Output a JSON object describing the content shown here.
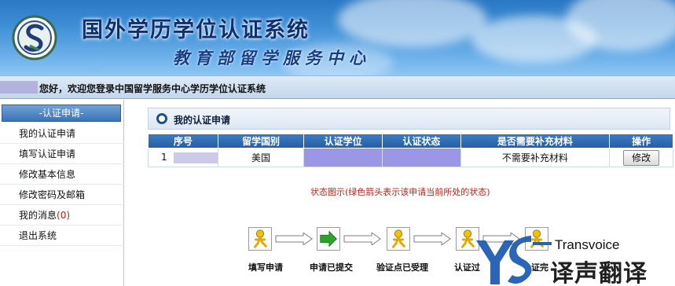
{
  "banner": {
    "title": "国外学历学位认证系统",
    "subtitle": "教育部留学服务中心"
  },
  "welcome": {
    "text": "您好，欢迎您登录中国留学服务中心学历学位认证系统"
  },
  "sidebar": {
    "header": "-认证申请-",
    "items": [
      {
        "label": "我的认证申请"
      },
      {
        "label": "填写认证申请"
      },
      {
        "label": "修改基本信息"
      },
      {
        "label": "修改密码及邮箱"
      },
      {
        "label": "我的消息",
        "badge": "(0)"
      },
      {
        "label": "退出系统"
      }
    ]
  },
  "panel": {
    "title": "我的认证申请"
  },
  "table": {
    "headers": [
      "序号",
      "留学国别",
      "认证学位",
      "认证状态",
      "是否需要补充材料",
      "操作"
    ],
    "rows": [
      {
        "index": "1",
        "country": "美国",
        "degree": "",
        "status": "",
        "supplement": "不需要补充材料",
        "action": "修改"
      }
    ]
  },
  "status_caption": "状态图示(绿色箭头表示该申请当前所处的状态)",
  "flow": {
    "steps": [
      {
        "label": "填写申请"
      },
      {
        "label": "申请已提交"
      },
      {
        "label": "验证点已受理"
      },
      {
        "label": "认证过"
      },
      {
        "label": "证完"
      }
    ]
  },
  "watermark": {
    "en": "Transvoice",
    "cn": "译声翻译"
  },
  "colors": {
    "header_blue": "#245da3",
    "current_arrow_green": "#2aa52a",
    "caption_red": "#c4221b"
  }
}
